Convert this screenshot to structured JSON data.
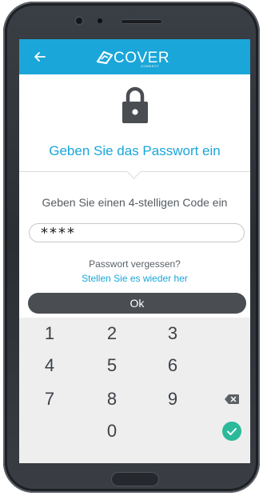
{
  "app": {
    "logo_text": "COVER",
    "logo_subtext": "CONNECT"
  },
  "header": {
    "back_icon": "arrow-left-icon",
    "title": "Geben Sie das Passwort ein"
  },
  "pin_entry": {
    "instruction": "Geben Sie einen 4-stelligen Code ein",
    "value": "****",
    "forgot_text": "Passwort vergessen?",
    "restore_link": "Stellen Sie es wieder her",
    "ok_label": "Ok"
  },
  "keypad": {
    "keys": [
      "1",
      "2",
      "3",
      "4",
      "5",
      "6",
      "7",
      "8",
      "9",
      "0"
    ],
    "backspace_icon": "backspace-icon",
    "confirm_icon": "check-circle-icon"
  },
  "colors": {
    "accent": "#1aa6d9",
    "ok_button": "#4a4d52",
    "confirm": "#2bb99a"
  }
}
